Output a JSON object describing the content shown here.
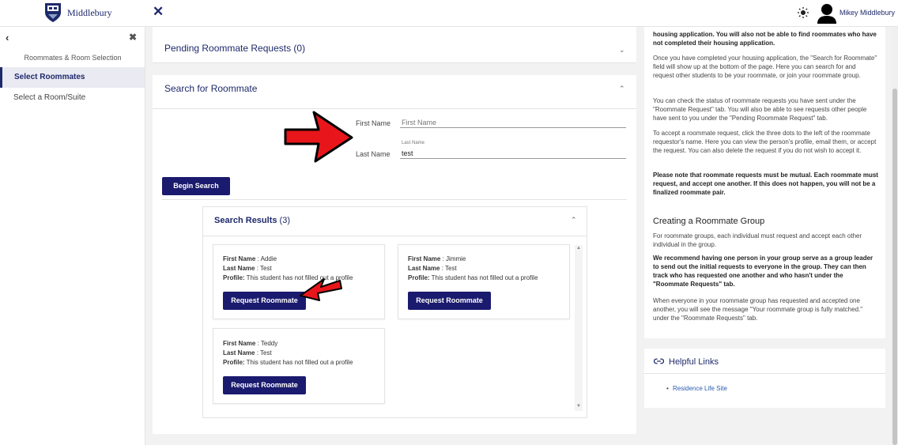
{
  "header": {
    "logo_text": "Middlebury",
    "user_name": "Mikey Middlebury"
  },
  "sidebar": {
    "title": "Roommates & Room Selection",
    "items": [
      {
        "label": "Select Roommates"
      },
      {
        "label": "Select a Room/Suite"
      }
    ]
  },
  "main": {
    "pending_title": "Pending Roommate Requests (0)",
    "search_title": "Search for Roommate",
    "first_name_label": "First Name",
    "first_name_placeholder": "First Name",
    "last_name_label": "Last Name",
    "last_name_floating": "Last Name",
    "last_name_value": "test",
    "begin_search_label": "Begin Search",
    "results_title": "Search Results",
    "results_count": "(3)",
    "first_name_key": "First Name",
    "last_name_key": "Last Name",
    "profile_key": "Profile:",
    "request_label": "Request Roommate",
    "results": [
      {
        "first": ": Addie",
        "last": ": Test",
        "profile": "This student has not filled out a profile"
      },
      {
        "first": ": Jimmie",
        "last": ": Test",
        "profile": "This student has not filled out a profile"
      },
      {
        "first": ": Teddy",
        "last": ": Test",
        "profile": "This student has not filled out a profile"
      }
    ]
  },
  "info": {
    "p1": "housing application. You will also not be able to find roommates who have not completed their housing application.",
    "p2": "Once you have completed your housing application, the \"Search for Roommate\" field will show up at the bottom of the page. Here you can search for and request other students to be your roommate, or join your roommate group.",
    "p3": "You can check the status of roommate requests you have sent under the \"Roommate Request\" tab. You will also be able to see requests other people have sent to you under the \"Pending Roommate Request\" tab.",
    "p4": "To accept a roommate request, click the three dots to the left of the roommate requestor's name. Here you can view the person's profile, email them, or accept the request. You can also delete the request if you do not wish to accept it.",
    "p5": "Please note that roommate requests must be mutual. Each roommate must request, and accept one another. If this does not happen, you will not be a finalized roommate pair.",
    "group_heading": "Creating a Roommate Group",
    "p6": "For roommate groups, each individual must request and accept each other individual in the group.",
    "p7": "We recommend having one person in your group serve as a group leader to send out the initial requests to everyone in the group. They can then track who has requested one another and who hasn't under the \"Roommate Requests\" tab.",
    "p8": "When everyone in your roommate group has requested and accepted one another, you will see the message \"Your roommate group is fully matched.\" under the \"Roommate Requests\" tab."
  },
  "links": {
    "title": "Helpful Links",
    "items": [
      {
        "label": "Residence Life Site"
      }
    ]
  },
  "colors": {
    "brand_navy": "#1f2a6b",
    "button": "#1a1a6e",
    "annotation_arrow": "#e8161b"
  }
}
